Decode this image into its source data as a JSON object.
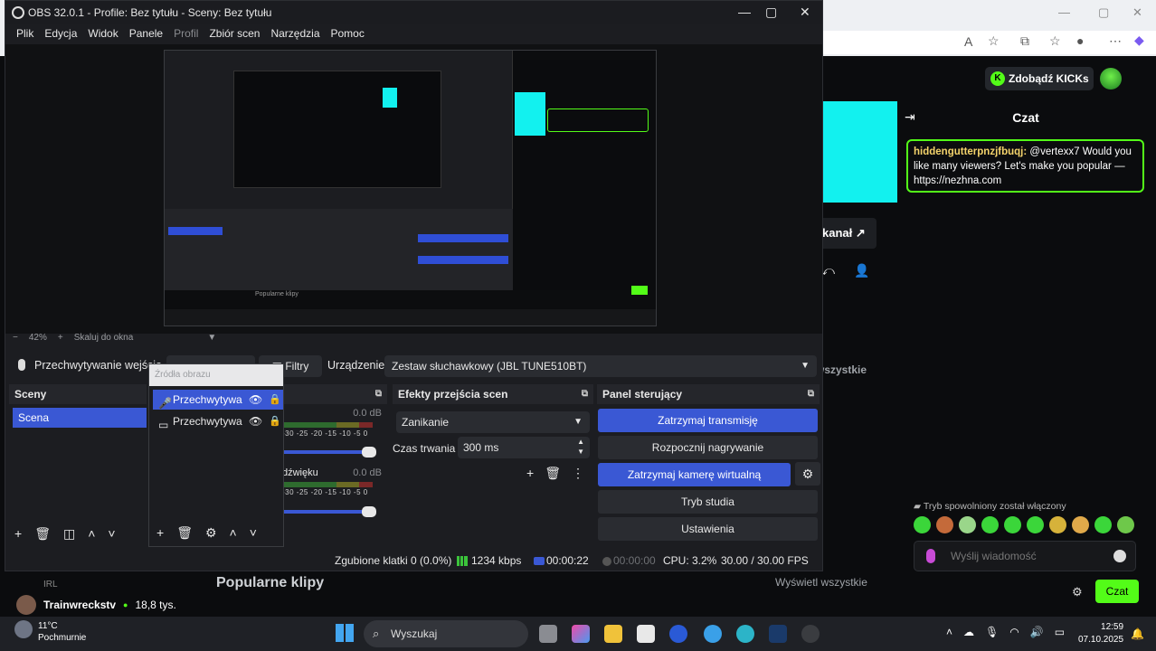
{
  "browser": {
    "kick_button": "Zdobądź KICKs",
    "chat_title": "Czat",
    "chat_message": {
      "user": "hiddengutterpnzjfbuqj:",
      "text": " @vertexx7 Would you like many viewers? Let's make you popular — https://nezhna.com"
    },
    "kanal_label": "kanał",
    "slow_mode": "Tryb spowolniony został włączony",
    "chat_placeholder": "Wyślij wiadomość",
    "chat_send": "Czat",
    "popular_clips": "Popularne klipy",
    "show_all": "Wyświetl wszystkie",
    "show_all_short": "wszystkie",
    "streamer": {
      "category": "IRL",
      "name": "Trainwreckstv",
      "viewers": "18,8 tys."
    }
  },
  "obs": {
    "title": "OBS 32.0.1 - Profile: Bez tytułu - Sceny: Bez tytułu",
    "menu": [
      "Plik",
      "Edycja",
      "Widok",
      "Panele",
      "Profil",
      "Zbiór scen",
      "Narzędzia",
      "Pomoc"
    ],
    "zoom": "42%",
    "zoom_fit": "Skaluj do okna",
    "source_name": "Przechwytywanie wejścia",
    "filters": "Filtry",
    "device_label": "Urządzenie",
    "device_value": "Zestaw słuchawkowy (JBL TUNE510BT)",
    "scenes_title": "Sceny",
    "scene_item": "Scena",
    "sources_header": "Źródła obrazu",
    "sources": [
      "Przechwytywa",
      "Przechwytywa"
    ],
    "mixer": {
      "db1": "0.0 dB",
      "db2": "0.0 dB",
      "scale": "-30 -25 -20 -15 -10 -5 0",
      "label2": "dźwięku"
    },
    "transitions_title": "Efekty przejścia scen",
    "transition_value": "Zanikanie",
    "duration_label": "Czas trwania",
    "duration_value": "300 ms",
    "controls_title": "Panel sterujący",
    "controls": [
      "Zatrzymaj transmisję",
      "Rozpocznij nagrywanie",
      "Zatrzymaj kamerę wirtualną",
      "Tryb studia",
      "Ustawienia"
    ],
    "status": {
      "dropped": "Zgubione klatki 0 (0.0%)",
      "bitrate": "1234 kbps",
      "stream_time": "00:00:22",
      "rec_time": "00:00:00",
      "cpu": "CPU: 3.2%",
      "fps": "30.00 / 30.00 FPS"
    },
    "preview_clips": "Popularne klipy"
  },
  "taskbar": {
    "temp": "11°C",
    "weather": "Pochmurnie",
    "search": "Wyszukaj",
    "time": "12:59",
    "date": "07.10.2025"
  },
  "colors": {
    "kick_green": "#53fc18",
    "obs_blue": "#3a58d4",
    "cyan": "#12f1ef"
  }
}
